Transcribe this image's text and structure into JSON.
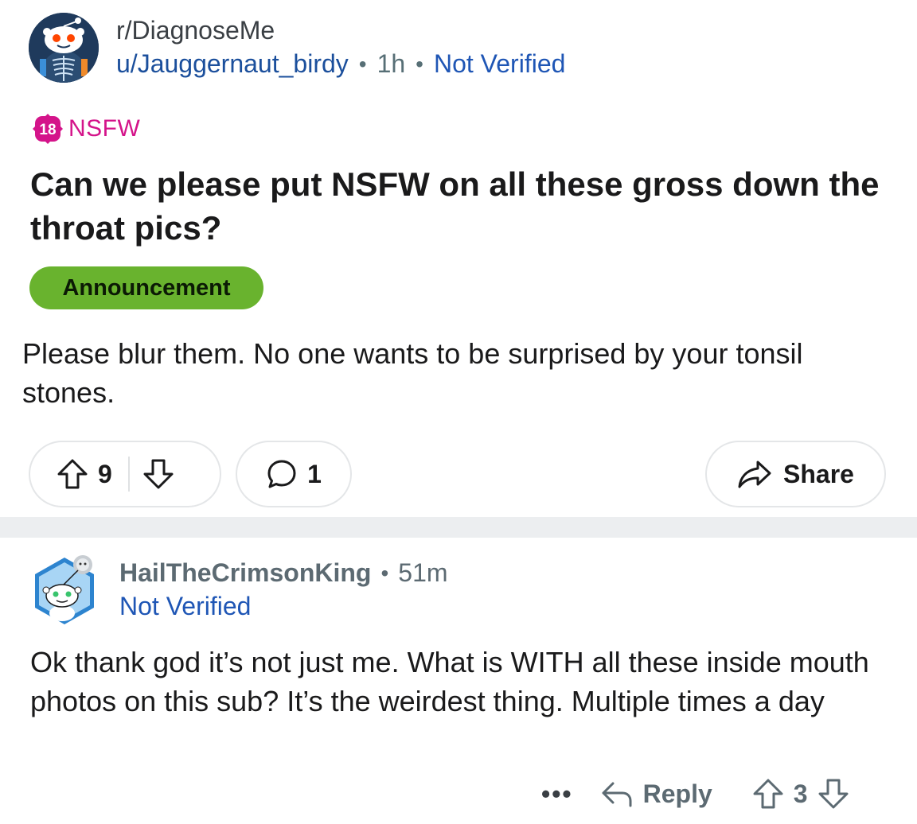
{
  "post": {
    "subreddit": "r/DiagnoseMe",
    "author": "u/Jauggernaut_birdy",
    "time": "1h",
    "verification": "Not Verified",
    "nsfw_badge_number": "18",
    "nsfw_label": "NSFW",
    "title": "Can we please put NSFW on all these gross down the throat pics?",
    "flair": "Announcement",
    "body": "Please blur them. No one wants to be surprised by your tonsil stones.",
    "score": "9",
    "comment_count": "1",
    "share_label": "Share"
  },
  "comment": {
    "author": "HailTheCrimsonKing",
    "time": "51m",
    "verification": "Not Verified",
    "body": "Ok thank god it’s not just me. What is WITH all these inside mouth photos on this sub? It’s the weirdest thing. Multiple times a day",
    "more_label": "•••",
    "reply_label": "Reply",
    "score": "3"
  },
  "colors": {
    "flair_bg": "#69b32e",
    "nsfw": "#d4148a",
    "link_blue": "#1f56b5"
  },
  "icons": {
    "upvote": "arrow-up-outline-icon",
    "downvote": "arrow-down-outline-icon",
    "comment": "speech-bubble-icon",
    "share": "share-arrow-icon",
    "reply": "reply-arrow-icon"
  }
}
